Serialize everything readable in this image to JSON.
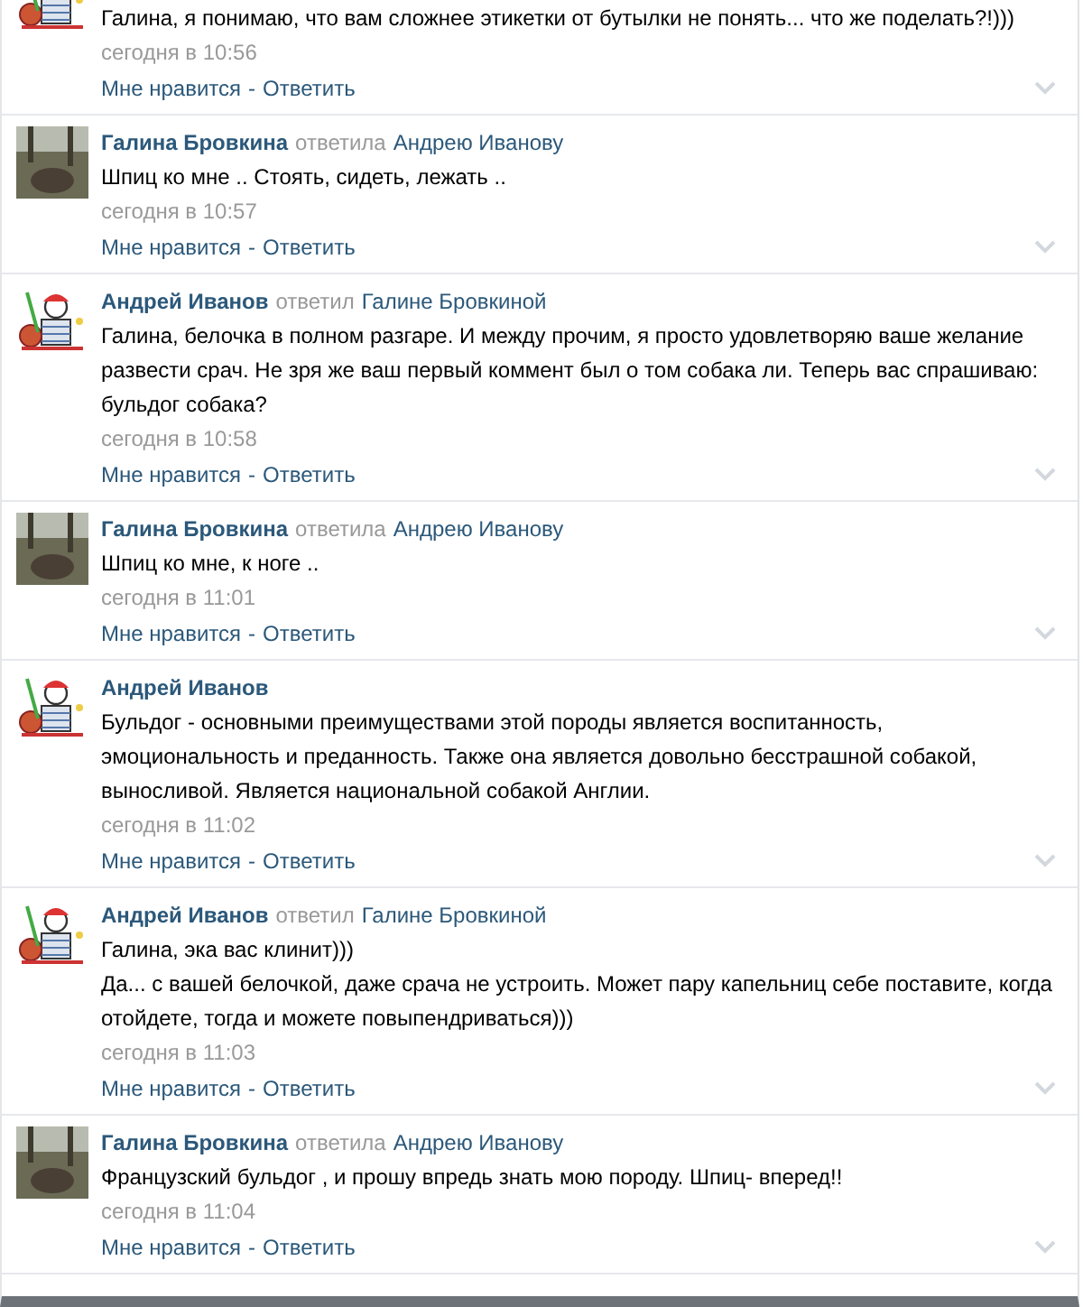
{
  "comments": [
    {
      "kind": "drawing",
      "body": [
        "Галина, я понимаю, что вам сложнее этикетки от бутылки не понять... что же поделать?!)))"
      ],
      "time": "сегодня в 10:56",
      "like": "Мне нравится",
      "separator": "-",
      "reply": "Ответить"
    },
    {
      "kind": "photo",
      "author": {
        "name": "Галина Бровкина",
        "verb": "ответила",
        "recipient": "Андрею Иванову"
      },
      "body": [
        "Шпиц ко мне .. Стоять, сидеть, лежать .."
      ],
      "time": "сегодня в 10:57",
      "like": "Мне нравится",
      "separator": "-",
      "reply": "Ответить"
    },
    {
      "kind": "drawing",
      "author": {
        "name": "Андрей Иванов",
        "verb": "ответил",
        "recipient": "Галине Бровкиной"
      },
      "body": [
        "Галина, белочка в полном разгаре. И между прочим, я просто удовлетворяю ваше желание развести срач. Не зря же ваш первый коммент был о том собака ли. Теперь вас спрашиваю: бульдог собака?"
      ],
      "time": "сегодня в 10:58",
      "like": "Мне нравится",
      "separator": "-",
      "reply": "Ответить"
    },
    {
      "kind": "photo",
      "author": {
        "name": "Галина Бровкина",
        "verb": "ответила",
        "recipient": "Андрею Иванову"
      },
      "body": [
        "Шпиц ко мне, к ноге .."
      ],
      "time": "сегодня в 11:01",
      "like": "Мне нравится",
      "separator": "-",
      "reply": "Ответить"
    },
    {
      "kind": "drawing",
      "author": {
        "name": "Андрей Иванов"
      },
      "body": [
        "Бульдог - основными преимуществами этой породы является воспитанность, эмоциональность и преданность. Также она является довольно бесстрашной собакой, выносливой. Является национальной собакой Англии."
      ],
      "time": "сегодня в 11:02",
      "like": "Мне нравится",
      "separator": "-",
      "reply": "Ответить"
    },
    {
      "kind": "drawing",
      "author": {
        "name": "Андрей Иванов",
        "verb": "ответил",
        "recipient": "Галине Бровкиной"
      },
      "body": [
        "Галина, эка вас клинит)))",
        "Да... с вашей белочкой, даже срача не устроить. Может пару капельниц себе поставите, когда отойдете, тогда и можете повыпендриваться)))"
      ],
      "time": "сегодня в 11:03",
      "like": "Мне нравится",
      "separator": "-",
      "reply": "Ответить"
    },
    {
      "kind": "photo",
      "author": {
        "name": "Галина Бровкина",
        "verb": "ответила",
        "recipient": "Андрею Иванову"
      },
      "body": [
        "Французский бульдог , и прошу впредь знать мою породу. Шпиц- вперед!!"
      ],
      "time": "сегодня в 11:04",
      "like": "Мне нравится",
      "separator": "-",
      "reply": "Ответить"
    }
  ]
}
